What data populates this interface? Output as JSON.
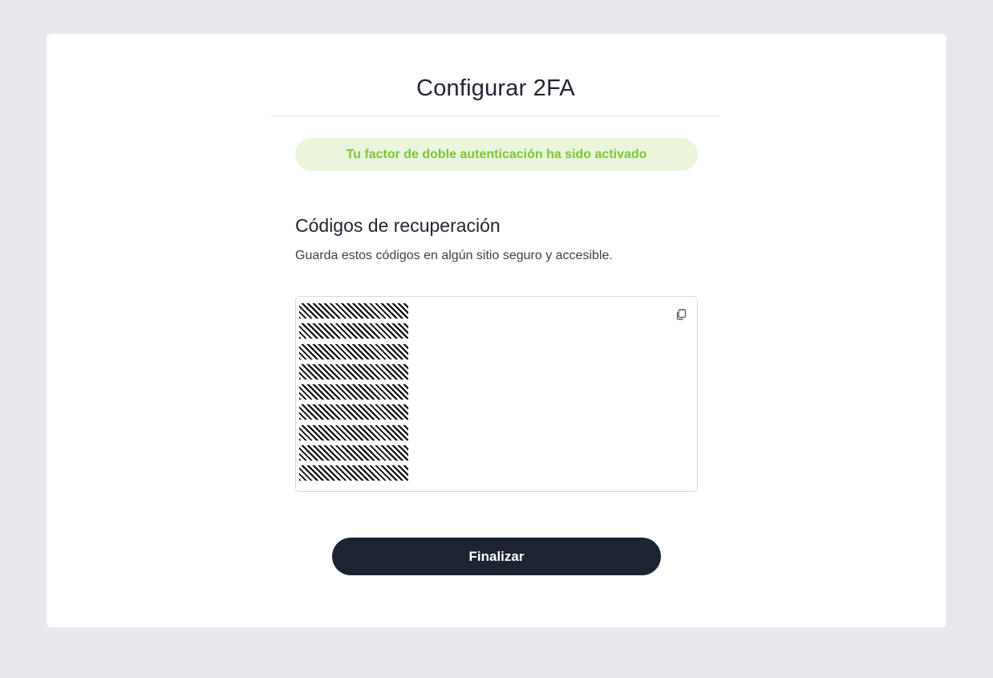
{
  "page": {
    "title": "Configurar 2FA"
  },
  "alert": {
    "message": "Tu factor de doble autenticación ha sido activado",
    "background_color": "#eaf5dc",
    "text_color": "#7cc33a"
  },
  "recovery": {
    "title": "Códigos de recuperación",
    "description": "Guarda estos códigos en algún sitio seguro y accesible.",
    "codes": [
      "",
      "",
      "",
      "",
      "",
      "",
      "",
      "",
      ""
    ],
    "codes_redacted": true,
    "copy_icon": "copy-icon"
  },
  "actions": {
    "finish_label": "Finalizar",
    "button_color": "#1c2434"
  }
}
